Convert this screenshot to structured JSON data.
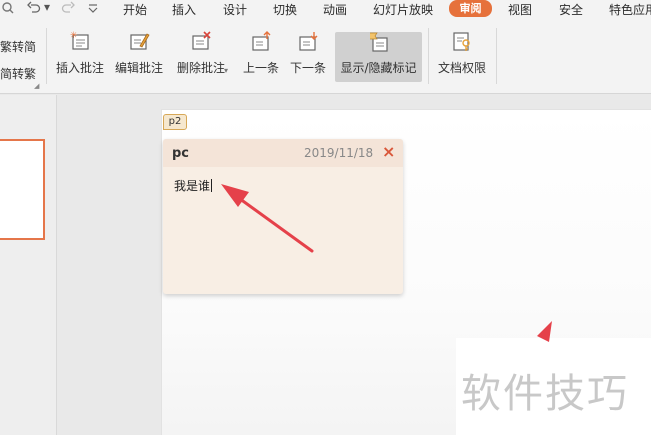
{
  "quick_access": {
    "undo_icon": "undo-icon",
    "redo_icon": "redo-icon",
    "customize_icon": "dropdown-arrow-icon"
  },
  "menu_tabs": [
    "开始",
    "插入",
    "设计",
    "切换",
    "动画",
    "幻灯片放映",
    "审阅",
    "视图",
    "安全",
    "特色应用"
  ],
  "active_tab": "审阅",
  "ribbon": {
    "side_labels": [
      "繁转简",
      "简转繁"
    ],
    "buttons": [
      {
        "label": "插入批注",
        "icon": "insert-comment-icon"
      },
      {
        "label": "编辑批注",
        "icon": "edit-comment-icon"
      },
      {
        "label": "删除批注",
        "icon": "delete-comment-icon"
      },
      {
        "label": "上一条",
        "icon": "previous-comment-icon"
      },
      {
        "label": "下一条",
        "icon": "next-comment-icon"
      },
      {
        "label": "显示/隐藏标记",
        "icon": "show-hide-markup-icon"
      },
      {
        "label": "文档权限",
        "icon": "document-permission-icon"
      }
    ]
  },
  "comment": {
    "marker": "p2",
    "author": "pc",
    "date": "2019/11/18",
    "close": "×",
    "text": "我是谁"
  },
  "colors": {
    "accent": "#e6713b",
    "annotation_arrow": "#e5414a",
    "comment_bg": "#f8eee4"
  },
  "watermark": "软件技巧"
}
